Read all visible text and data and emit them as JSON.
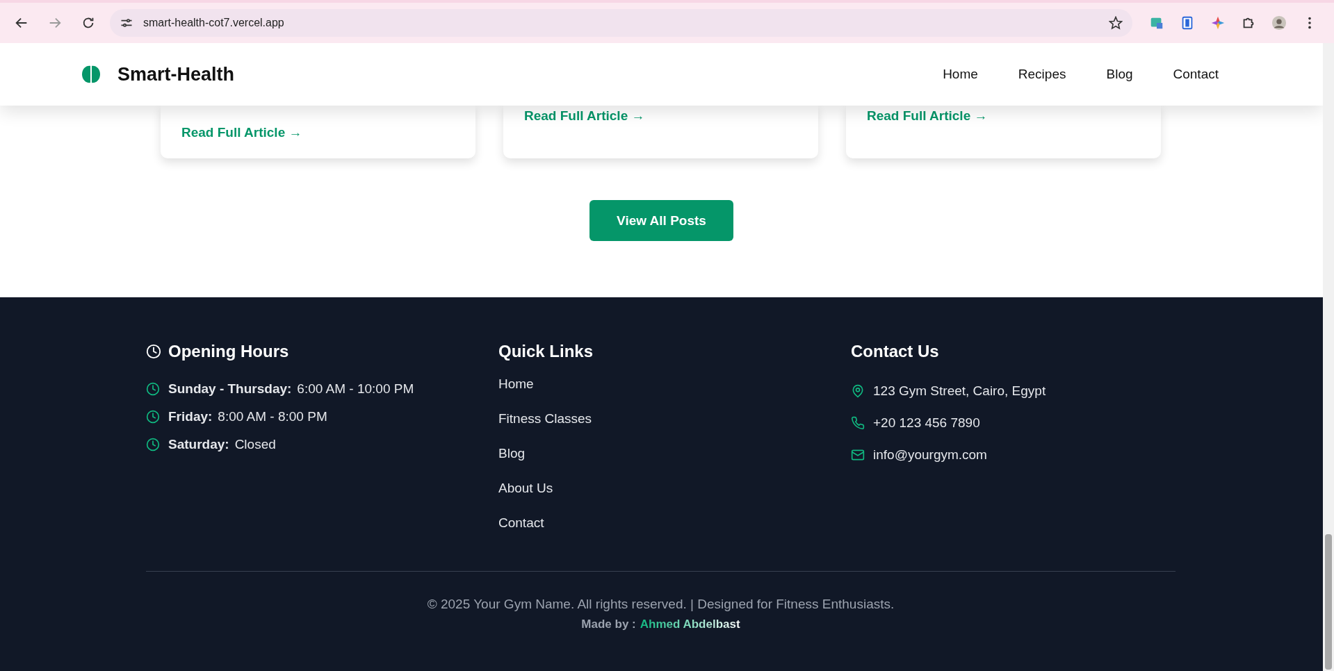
{
  "browser": {
    "buttons": [
      {
        "kind": "back",
        "disabled": false
      },
      {
        "kind": "forward",
        "disabled": true
      },
      {
        "kind": "reload",
        "disabled": false
      }
    ],
    "url": "smart-health-cot7.vercel.app"
  },
  "header": {
    "brand": "Smart-Health",
    "nav": [
      "Home",
      "Recipes",
      "Blog",
      "Contact"
    ]
  },
  "cards": [
    {
      "link": "Read Full Article →",
      "kind": "full"
    },
    {
      "link": "Read Full Article →",
      "kind": "raised"
    },
    {
      "link": "Read Full Article →",
      "kind": "raised"
    }
  ],
  "view_all_button": "View All Posts",
  "footer": {
    "hours": {
      "title": "Opening Hours",
      "items": [
        {
          "day": "Sunday - Thursday:",
          "time": "6:00 AM - 10:00 PM"
        },
        {
          "day": "Friday:",
          "time": "8:00 AM - 8:00 PM"
        },
        {
          "day": "Saturday:",
          "time": "Closed"
        }
      ]
    },
    "links": {
      "title": "Quick Links",
      "items": [
        "Home",
        "Fitness Classes",
        "Blog",
        "About Us",
        "Contact"
      ]
    },
    "contact": {
      "title": "Contact Us",
      "items": [
        {
          "kind": "address",
          "text": "123 Gym Street, Cairo, Egypt"
        },
        {
          "kind": "phone",
          "text": "+20 123 456 7890"
        },
        {
          "kind": "email",
          "text": "info@yourgym.com"
        }
      ]
    },
    "copyright": "© 2025 Your Gym Name. All rights reserved. | Designed for Fitness Enthusiasts.",
    "made_by_label": "Made by :",
    "made_by_name": "Ahmed Abdelbast"
  }
}
